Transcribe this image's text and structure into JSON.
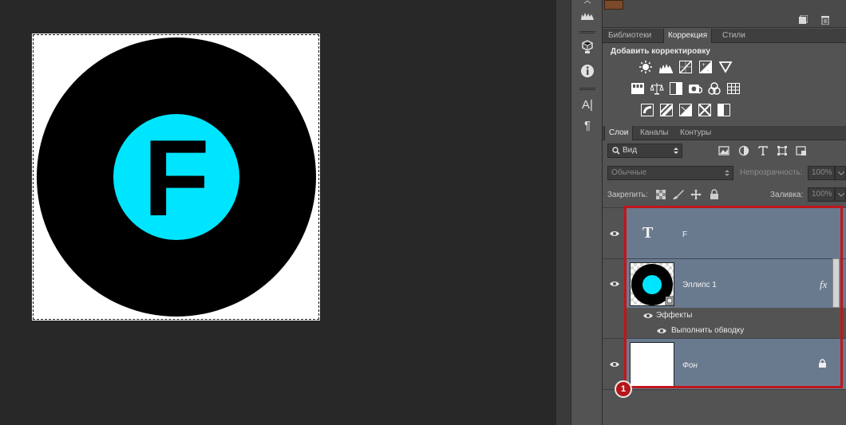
{
  "canvas": {
    "letter": "F",
    "colors": {
      "outer_circle": "#000000",
      "inner_circle": "#00e5ff",
      "letter": "#000000",
      "background": "#ffffff"
    }
  },
  "toolstrip": {
    "icons": [
      "palette-icon",
      "cube-info-icon",
      "info-icon",
      "character-icon",
      "paragraph-icon"
    ],
    "character_glyph": "A|",
    "paragraph_glyph": "¶",
    "info_glyph": "i"
  },
  "top_strip": {
    "icons": [
      "new-layer-icon",
      "trash-icon"
    ]
  },
  "adjustments": {
    "tabs": [
      "Библиотеки",
      "Коррекция",
      "Стили"
    ],
    "active_tab": "Коррекция",
    "title": "Добавить корректировку",
    "icons": [
      "brightness-icon",
      "levels-icon",
      "curves-icon",
      "exposure-icon",
      "vibrance-icon",
      "hue-saturation-icon",
      "color-balance-icon",
      "black-white-icon",
      "photo-filter-icon",
      "channel-mixer-icon",
      "color-lookup-icon",
      "invert-icon",
      "posterize-icon",
      "threshold-icon",
      "selective-color-icon",
      "gradient-map-icon"
    ]
  },
  "layers": {
    "tabs": [
      "Слои",
      "Каналы",
      "Контуры"
    ],
    "active_tab": "Слои",
    "filter_label": "Вид",
    "blend_mode": "Обычные",
    "opacity_label": "Непрозрачность:",
    "opacity_value": "100%",
    "lock_label": "Закрепить:",
    "fill_label": "Заливка:",
    "fill_value": "100%",
    "items": [
      {
        "name": "F",
        "type": "text",
        "thumb_glyph": "T"
      },
      {
        "name": "Эллипс 1",
        "type": "shape",
        "fx": "fx"
      },
      {
        "name": "Фон",
        "type": "background"
      }
    ],
    "effects_label": "Эффекты",
    "effect_item": "Выполнить обводку"
  },
  "annotation": {
    "badge": "1",
    "color": "#c0161b"
  }
}
